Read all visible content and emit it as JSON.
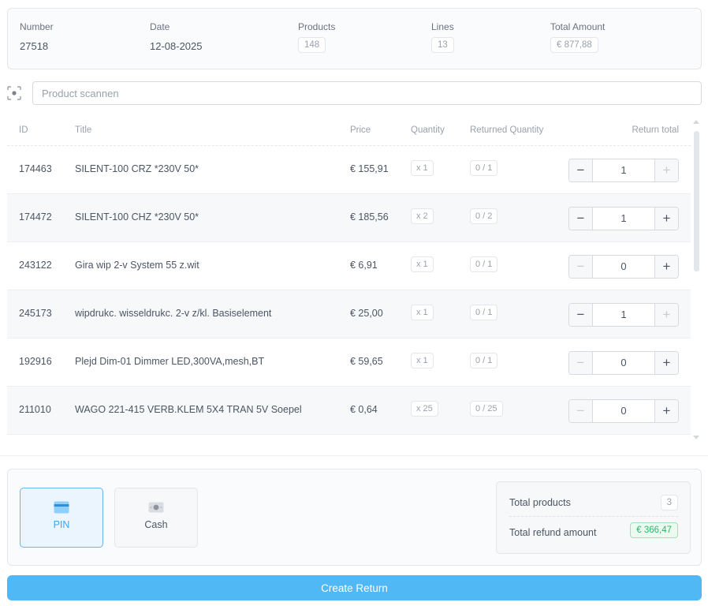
{
  "summary": {
    "number_label": "Number",
    "number_value": "27518",
    "date_label": "Date",
    "date_value": "12-08-2025",
    "products_label": "Products",
    "products_value": "148",
    "lines_label": "Lines",
    "lines_value": "13",
    "total_label": "Total Amount",
    "total_value": "€ 877,88"
  },
  "scan": {
    "placeholder": "Product scannen",
    "icon": "scan-icon"
  },
  "table": {
    "headers": {
      "id": "ID",
      "title": "Title",
      "price": "Price",
      "quantity": "Quantity",
      "returned": "Returned Quantity",
      "total": "Return total"
    },
    "rows": [
      {
        "id": "174463",
        "title": "SILENT-100 CRZ *230V 50*",
        "price": "€ 155,91",
        "qty": "x 1",
        "returned": "0 / 1",
        "value": "1",
        "minus_enabled": true,
        "plus_enabled": false
      },
      {
        "id": "174472",
        "title": "SILENT-100 CHZ *230V 50*",
        "price": "€ 185,56",
        "qty": "x 2",
        "returned": "0 / 2",
        "value": "1",
        "minus_enabled": true,
        "plus_enabled": true
      },
      {
        "id": "243122",
        "title": "Gira wip 2-v System 55 z.wit",
        "price": "€ 6,91",
        "qty": "x 1",
        "returned": "0 / 1",
        "value": "0",
        "minus_enabled": false,
        "plus_enabled": true
      },
      {
        "id": "245173",
        "title": "wipdrukc. wisseldrukc. 2-v z/kl. Basiselement",
        "price": "€ 25,00",
        "qty": "x 1",
        "returned": "0 / 1",
        "value": "1",
        "minus_enabled": true,
        "plus_enabled": false
      },
      {
        "id": "192916",
        "title": "Plejd Dim-01 Dimmer LED,300VA,mesh,BT",
        "price": "€ 59,65",
        "qty": "x 1",
        "returned": "0 / 1",
        "value": "0",
        "minus_enabled": false,
        "plus_enabled": true
      },
      {
        "id": "211010",
        "title": "WAGO 221-415 VERB.KLEM 5X4 TRAN 5V Soepel",
        "price": "€ 0,64",
        "qty": "x 25",
        "returned": "0 / 25",
        "value": "0",
        "minus_enabled": false,
        "plus_enabled": true
      }
    ]
  },
  "payment": {
    "methods": [
      {
        "label": "PIN",
        "icon": "card-icon",
        "active": true
      },
      {
        "label": "Cash",
        "icon": "cash-icon",
        "active": false
      }
    ]
  },
  "totals": {
    "products_label": "Total products",
    "products_value": "3",
    "refund_label": "Total refund amount",
    "refund_value": "€ 366,47"
  },
  "actions": {
    "create_label": "Create Return"
  },
  "colors": {
    "accent": "#4fb8f5",
    "active_blue": "#3ba8ef",
    "success": "#2fb36a"
  }
}
